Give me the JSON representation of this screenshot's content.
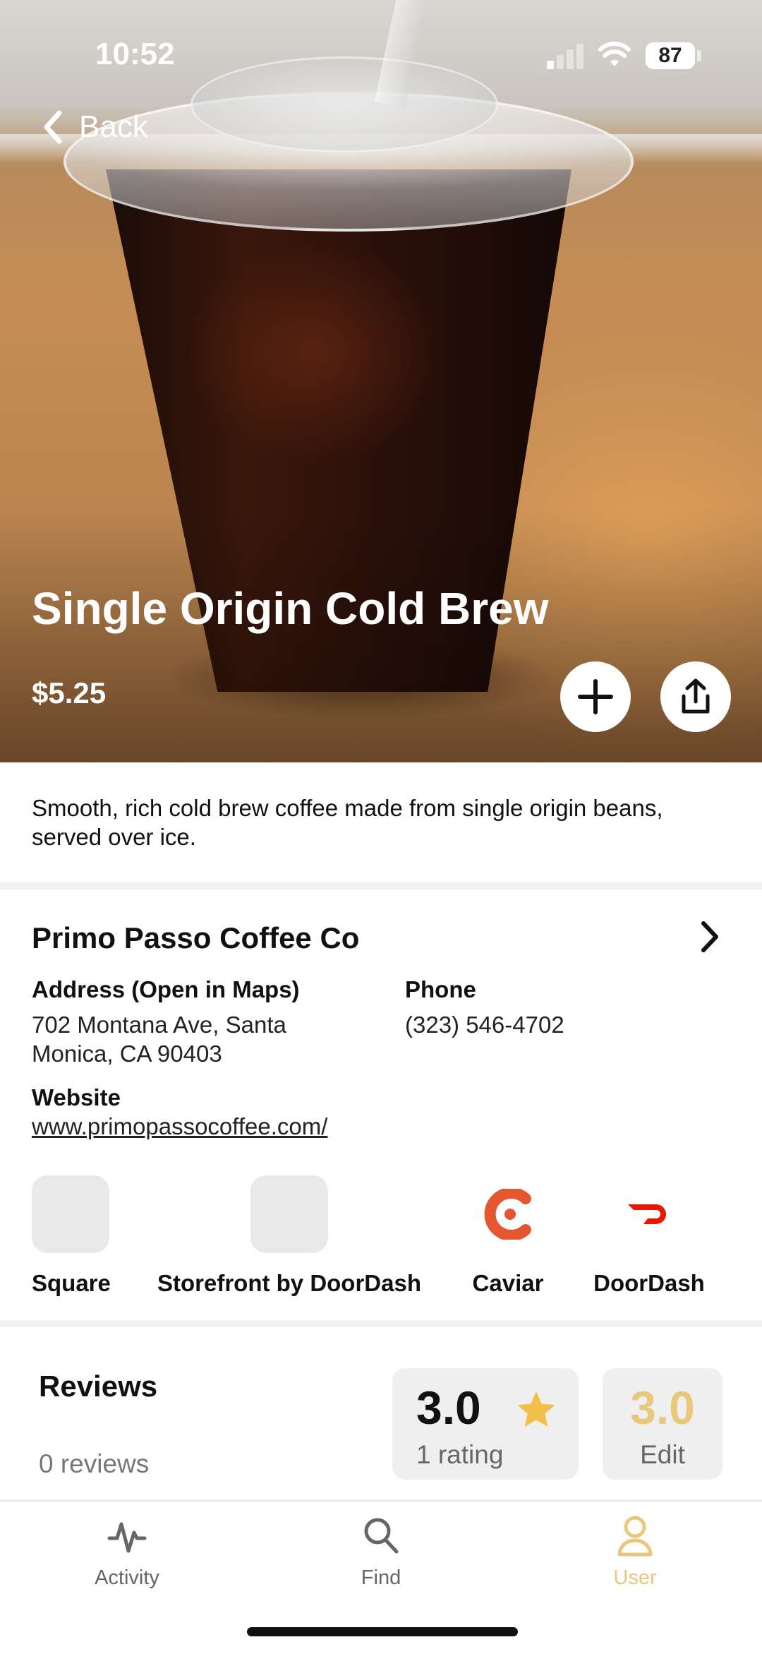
{
  "status_bar": {
    "time": "10:52",
    "battery": "87"
  },
  "nav": {
    "back_label": "Back"
  },
  "item": {
    "name": "Single Origin Cold Brew",
    "price": "$5.25",
    "description": "Smooth, rich cold brew coffee made from single origin beans, served over ice."
  },
  "shop": {
    "name": "Primo Passo Coffee Co",
    "address_label": "Address (Open in Maps)",
    "address_line1": "702 Montana Ave, Santa",
    "address_line2": "Monica, CA 90403",
    "phone_label": "Phone",
    "phone": "(323) 546-4702",
    "website_label": "Website",
    "website": "www.primopassocoffee.com/"
  },
  "partners": [
    {
      "label": "Square",
      "icon": "square-logo-placeholder"
    },
    {
      "label": "Storefront by DoorDash",
      "icon": "storefront-logo-placeholder"
    },
    {
      "label": "Caviar",
      "icon": "caviar-logo",
      "color": "#e4572e"
    },
    {
      "label": "DoorDash",
      "icon": "doordash-logo",
      "color": "#eb1700"
    }
  ],
  "reviews": {
    "title": "Reviews",
    "count_text": "0 reviews",
    "average": "3.0",
    "rating_count_text": "1 rating",
    "my_rating": "3.0",
    "edit_label": "Edit"
  },
  "tabs": [
    {
      "label": "Activity",
      "icon": "activity-icon",
      "active": false
    },
    {
      "label": "Find",
      "icon": "search-icon",
      "active": false
    },
    {
      "label": "User",
      "icon": "user-icon",
      "active": true
    }
  ],
  "colors": {
    "accent": "#e9c77c",
    "caviar": "#e4572e",
    "doordash": "#eb1700",
    "star": "#f0c04a"
  }
}
